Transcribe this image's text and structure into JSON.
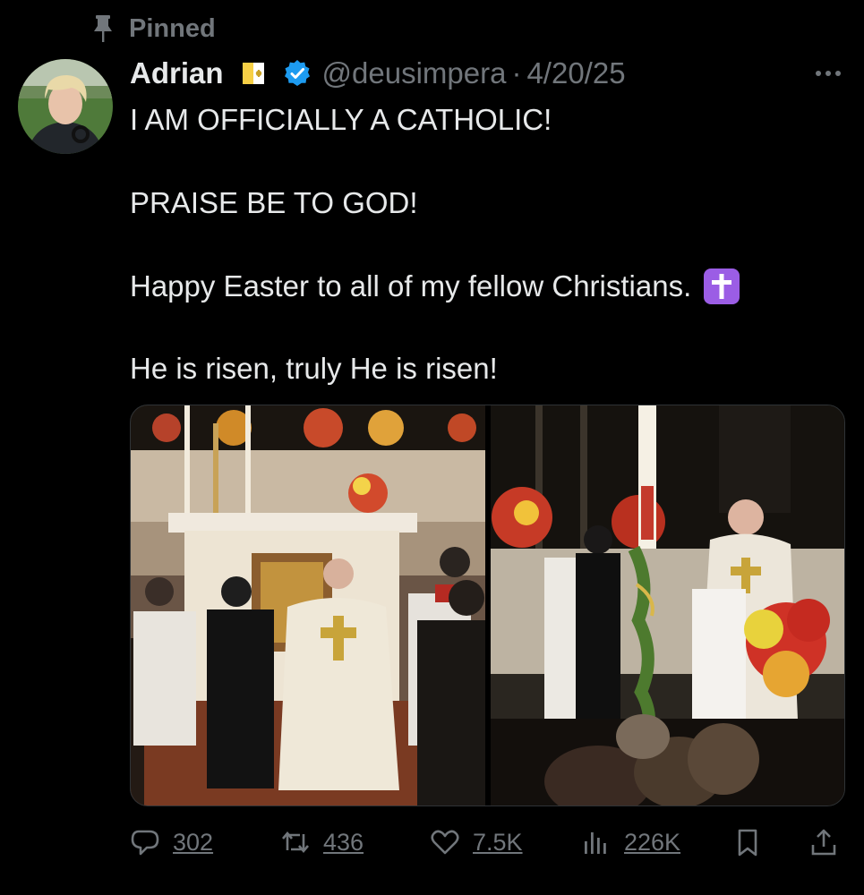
{
  "pinned": {
    "label": "Pinned",
    "icon": "pin-icon"
  },
  "author": {
    "display_name": "Adrian",
    "handle": "@deusimpera",
    "separator": "·",
    "date": "4/20/25",
    "flag_icon": "vatican-flag-icon",
    "verified_icon": "verified-badge-icon",
    "verified_color": "#1d9bf0"
  },
  "tweet": {
    "lines": [
      "I AM OFFICIALLY A CATHOLIC!",
      "PRAISE BE TO GOD!",
      "Happy Easter to all of my fellow Christians.",
      "He is risen, truly He is risen!"
    ],
    "emoji": "latin-cross-emoji"
  },
  "media": {
    "photos": [
      {
        "subject": "altar-kneeling-photo"
      },
      {
        "subject": "paschal-candle-photo"
      }
    ]
  },
  "actions": {
    "replies": "302",
    "reposts": "436",
    "likes": "7.5K",
    "views": "226K"
  },
  "colors": {
    "background": "#000000",
    "text": "#e7e9ea",
    "muted": "#71767b",
    "accent": "#1d9bf0",
    "emoji_bg": "#9b5de5"
  }
}
